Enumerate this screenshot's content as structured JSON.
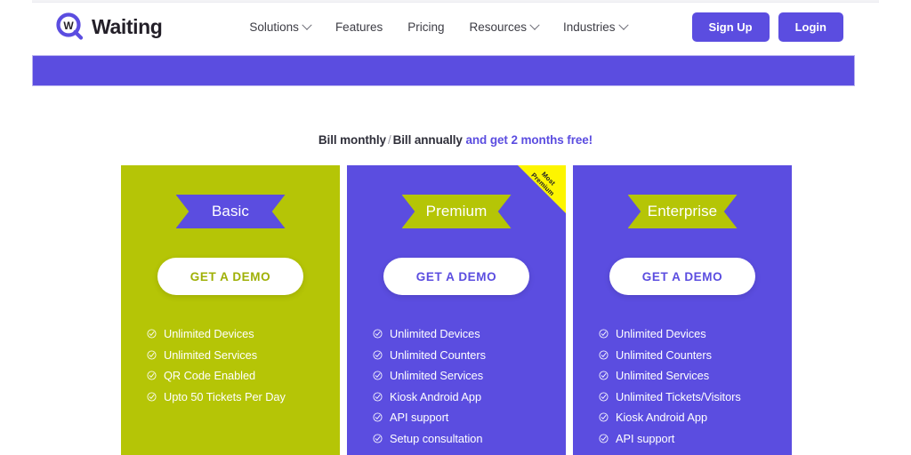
{
  "header": {
    "brand": {
      "name": "Waiting",
      "logo_icon": "magnifier-w-icon",
      "logo_color": "#5b4de0"
    },
    "nav": [
      {
        "label": "Solutions",
        "has_dropdown": true,
        "icon": "chevron-down-icon"
      },
      {
        "label": "Features",
        "has_dropdown": false,
        "icon": ""
      },
      {
        "label": "Pricing",
        "has_dropdown": false,
        "icon": ""
      },
      {
        "label": "Resources",
        "has_dropdown": true,
        "icon": "chevron-down-icon"
      },
      {
        "label": "Industries",
        "has_dropdown": true,
        "icon": "chevron-down-icon"
      }
    ],
    "auth": {
      "signup_label": "Sign Up",
      "login_label": "Login",
      "button_color": "#5b4de0"
    }
  },
  "billing": {
    "monthly_label": "Bill monthly",
    "separator": "/",
    "annual_label": "Bill annually",
    "promo_label": "and get 2 months free!",
    "promo_color": "#5b4de0"
  },
  "pricing": {
    "cards": [
      {
        "name": "Basic",
        "bg_color": "#b5c506",
        "ribbon_color": "#5b4de0",
        "cta_label": "GET A DEMO",
        "cta_text_color": "#9fb006",
        "badge": null,
        "features": [
          "Unlimited Devices",
          "Unlimited Services",
          "QR Code Enabled",
          "Upto 50 Tickets Per Day"
        ]
      },
      {
        "name": "Premium",
        "bg_color": "#5b4de0",
        "ribbon_color": "#b5c506",
        "cta_label": "GET A DEMO",
        "cta_text_color": "#5b4de0",
        "badge": {
          "line1": "Most",
          "line2": "Premium",
          "color": "#fdf500"
        },
        "features": [
          "Unlimited Devices",
          "Unlimited Counters",
          "Unlimited Services",
          "Kiosk Android App",
          "API support",
          "Setup consultation"
        ]
      },
      {
        "name": "Enterprise",
        "bg_color": "#5b4de0",
        "ribbon_color": "#b5c506",
        "cta_label": "GET A DEMO",
        "cta_text_color": "#5b4de0",
        "badge": null,
        "features": [
          "Unlimited Devices",
          "Unlimited Counters",
          "Unlimited Services",
          "Unlimited Tickets/Visitors",
          "Kiosk Android App",
          "API support"
        ]
      }
    ]
  }
}
